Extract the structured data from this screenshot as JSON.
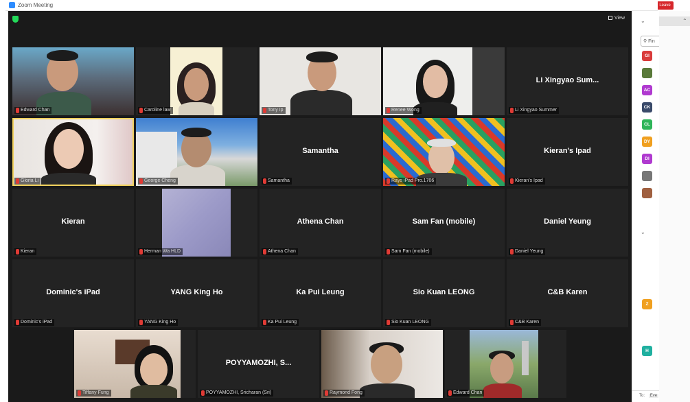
{
  "window": {
    "title": "Zoom Meeting",
    "leave_label": "Leave"
  },
  "toolbar": {
    "view_label": "View"
  },
  "tiles": [
    {
      "display_name": "Edward Chan",
      "big_name": ""
    },
    {
      "display_name": "Caroline law",
      "big_name": ""
    },
    {
      "display_name": "Tony Ip",
      "big_name": ""
    },
    {
      "display_name": "Renee Wong",
      "big_name": ""
    },
    {
      "display_name": "Li Xingyao Summer",
      "big_name": "Li Xingyao Sum..."
    },
    {
      "display_name": "Gloria Li",
      "big_name": ""
    },
    {
      "display_name": "George Cheng",
      "big_name": ""
    },
    {
      "display_name": "Samantha",
      "big_name": "Samantha"
    },
    {
      "display_name": "Rays iPad Pro.1706",
      "big_name": ""
    },
    {
      "display_name": "Kieran's Ipad",
      "big_name": "Kieran's Ipad"
    },
    {
      "display_name": "Kieran",
      "big_name": "Kieran"
    },
    {
      "display_name": "Herman Wa HLD",
      "big_name": ""
    },
    {
      "display_name": "Athena Chan",
      "big_name": "Athena Chan"
    },
    {
      "display_name": "Sam Fan (mobile)",
      "big_name": "Sam Fan (mobile)"
    },
    {
      "display_name": "Daniel Yeung",
      "big_name": "Daniel Yeung"
    },
    {
      "display_name": "Dominic's iPad",
      "big_name": "Dominic's iPad"
    },
    {
      "display_name": "YANG King Ho",
      "big_name": "YANG King Ho"
    },
    {
      "display_name": "Ka Pui Leung",
      "big_name": "Ka Pui Leung"
    },
    {
      "display_name": "Sio Kuan LEONG",
      "big_name": "Sio Kuan LEONG"
    },
    {
      "display_name": "C&B Karen",
      "big_name": "C&B Karen"
    },
    {
      "display_name": "Tiffany Fung",
      "big_name": ""
    },
    {
      "display_name": "POYYAMOZHI, Sricharan (Sri)",
      "big_name": "POYYAMOZHI, S..."
    },
    {
      "display_name": "Raymond Fong",
      "big_name": ""
    },
    {
      "display_name": "Edward Chan",
      "big_name": ""
    }
  ],
  "sidebar": {
    "search_placeholder": "Fin",
    "avatars": [
      {
        "initials": "GI",
        "color": "#d93b3b"
      },
      {
        "initials": "",
        "color": "#5a7a3a"
      },
      {
        "initials": "AC",
        "color": "#b03ad0"
      },
      {
        "initials": "CK",
        "color": "#3a4a6a"
      },
      {
        "initials": "CL",
        "color": "#2fb55a"
      },
      {
        "initials": "DY",
        "color": "#f0a020"
      },
      {
        "initials": "DI",
        "color": "#b03ad0"
      },
      {
        "initials": "",
        "color": "#777777"
      },
      {
        "initials": "",
        "color": "#a06040"
      },
      {
        "initials": "Z",
        "color": "#f0a020"
      },
      {
        "initials": "H",
        "color": "#20b0a0"
      }
    ],
    "bottom_to": "To:",
    "bottom_every": "Eve"
  }
}
